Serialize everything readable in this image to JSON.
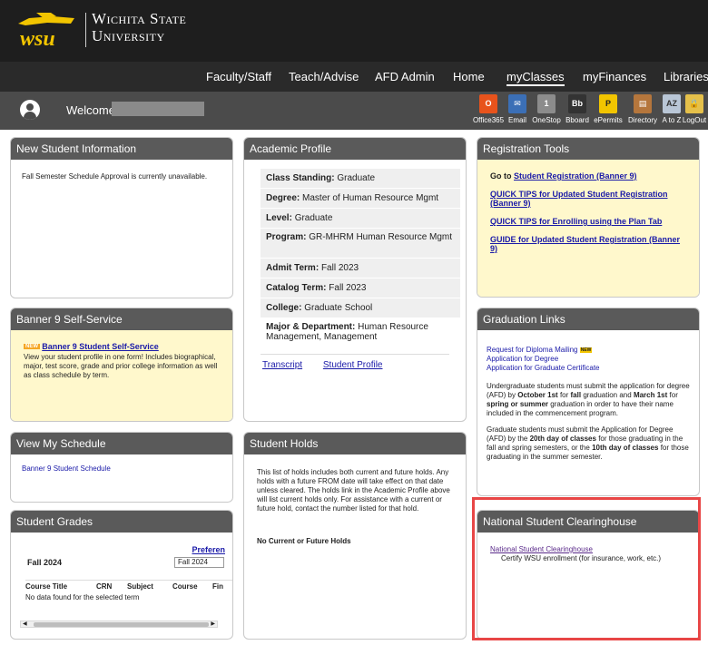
{
  "brand": {
    "mark": "wsu",
    "name_line1": "Wichita State",
    "name_line2": "University"
  },
  "nav": [
    {
      "label": "Faculty/Staff",
      "active": false
    },
    {
      "label": "Teach/Advise",
      "active": false
    },
    {
      "label": "AFD Admin",
      "active": false
    },
    {
      "label": "Home",
      "active": false
    },
    {
      "label": "myClasses",
      "active": true
    },
    {
      "label": "myFinances",
      "active": false
    },
    {
      "label": "Libraries",
      "active": false
    }
  ],
  "welcome": {
    "text": "Welcome,"
  },
  "tools": [
    {
      "label": "Office365",
      "icon": "office365-icon",
      "glyph": "O",
      "color": "#e8531c"
    },
    {
      "label": "Email",
      "icon": "email-icon",
      "glyph": "✉",
      "color": "#3b6fb6"
    },
    {
      "label": "OneStop",
      "icon": "onestop-icon",
      "glyph": "1",
      "color": "#8c8c8c"
    },
    {
      "label": "Bboard",
      "icon": "blackboard-icon",
      "glyph": "Bb",
      "color": "#333333"
    },
    {
      "label": "ePermits",
      "icon": "epermits-icon",
      "glyph": "P",
      "color": "#f2c500"
    },
    {
      "label": "Directory",
      "icon": "directory-icon",
      "glyph": "▤",
      "color": "#b5763c"
    },
    {
      "label": "A to Z",
      "icon": "a-to-z-icon",
      "glyph": "AZ",
      "color": "#b9c6d6"
    },
    {
      "label": "LogOut",
      "icon": "logout-icon",
      "glyph": "🔒",
      "color": "#e5c04a"
    }
  ],
  "new_student_info": {
    "title": "New Student Information",
    "text": "Fall Semester Schedule Approval is currently unavailable."
  },
  "banner9": {
    "title": "Banner 9 Self-Service",
    "badge": "NEW",
    "link": "Banner 9 Student Self-Service",
    "text": "View your student profile in one form! Includes biographical, major, test score, grade and prior college information as well as class schedule by term."
  },
  "view_schedule": {
    "title": "View My Schedule",
    "link": "Banner 9 Student Schedule"
  },
  "grades": {
    "title": "Student Grades",
    "preferences": "Preferen",
    "term_label": "Fall 2024",
    "term_select": "Fall 2024",
    "columns": [
      "Course Title",
      "CRN",
      "Subject",
      "Course",
      "Fin"
    ],
    "empty": "No data found for the selected term"
  },
  "academic_profile": {
    "title": "Academic Profile",
    "rows": [
      {
        "label": "Class Standing:",
        "value": "Graduate"
      },
      {
        "label": "Degree:",
        "value": "Master of Human Resource Mgmt"
      },
      {
        "label": "Level:",
        "value": "Graduate"
      },
      {
        "label": "Program:",
        "value": "GR-MHRM Human Resource Mgmt"
      },
      {
        "label": "Admit Term:",
        "value": "Fall 2023"
      },
      {
        "label": "Catalog Term:",
        "value": "Fall 2023"
      },
      {
        "label": "College:",
        "value": "Graduate School"
      },
      {
        "label": "Major & Department:",
        "value": "Human Resource Management, Management"
      }
    ],
    "transcript": "Transcript",
    "student_profile": "Student Profile"
  },
  "holds": {
    "title": "Student Holds",
    "text": "This list of holds includes both current and future holds. Any holds with a future FROM date will take effect on that date unless cleared. The holds link in the Academic Profile above will list current holds only. For assistance with a current or future hold, contact the number listed for that hold.",
    "status": "No Current or Future Holds"
  },
  "registration": {
    "title": "Registration Tools",
    "go_to": "Go to",
    "reg_link": "Student Registration (Banner 9)",
    "quick_tips_updated": "QUICK TIPS for Updated Student Registration (Banner 9)",
    "quick_tips_plan": "QUICK TIPS for Enrolling using the Plan Tab",
    "guide": "GUIDE for Updated Student Registration (Banner 9)"
  },
  "graduation": {
    "title": "Graduation Links",
    "link1": "Request for Diploma Mailing",
    "badge": "NEW",
    "link2": "Application for Degree",
    "link3": "Application for Graduate Certificate",
    "p1_a": "Undergraduate students must submit the application for degree (AFD) by",
    "p1_b": "October 1st",
    "p1_c": "for",
    "p1_d": "fall",
    "p1_e": "graduation and",
    "p1_f": "March 1st",
    "p1_g": "for",
    "p1_h": "spring or summer",
    "p1_i": "graduation in order to have their name included in the commencement program.",
    "p2_a": "Graduate students must submit the Application for Degree (AFD) by the",
    "p2_b": "20th day of classes",
    "p2_c": "for those graduating in the fall and spring semesters, or the",
    "p2_d": "10th day of classes",
    "p2_e": "for those graduating in the summer semester."
  },
  "clearinghouse": {
    "title": "National Student Clearinghouse",
    "link": "National Student Clearinghouse",
    "text": "Certify WSU enrollment (for insurance, work, etc.)"
  },
  "colors": {
    "header_bg": "#1e1e1e",
    "brand_gold": "#f2c500",
    "panel_head": "#5a5a5a",
    "yellow_panel": "#fff8cc",
    "highlight": "#e84646"
  }
}
